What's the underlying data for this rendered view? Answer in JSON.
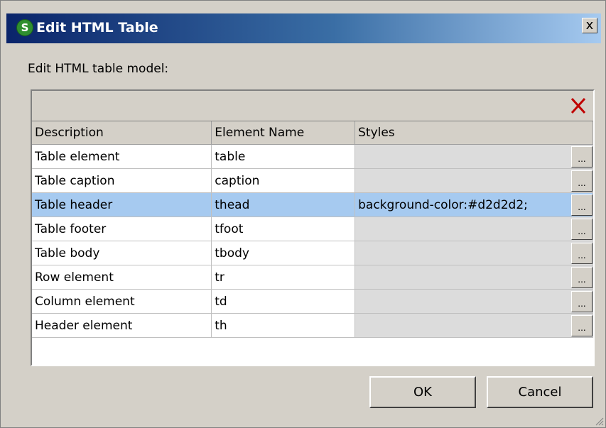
{
  "window": {
    "title": "Edit HTML Table",
    "close_label": "x",
    "app_icon_glyph": "S"
  },
  "prompt": "Edit HTML table model:",
  "columns": [
    "Description",
    "Element Name",
    "Styles"
  ],
  "rows": [
    {
      "description": "Table element",
      "element": "table",
      "styles": ""
    },
    {
      "description": "Table caption",
      "element": "caption",
      "styles": ""
    },
    {
      "description": "Table header",
      "element": "thead",
      "styles": "background-color:#d2d2d2;"
    },
    {
      "description": "Table footer",
      "element": "tfoot",
      "styles": ""
    },
    {
      "description": "Table body",
      "element": "tbody",
      "styles": ""
    },
    {
      "description": "Row element",
      "element": "tr",
      "styles": ""
    },
    {
      "description": "Column element",
      "element": "td",
      "styles": ""
    },
    {
      "description": "Header element",
      "element": "th",
      "styles": ""
    }
  ],
  "selected_row": 2,
  "ellipsis_label": "...",
  "buttons": {
    "ok": "OK",
    "cancel": "Cancel"
  },
  "colors": {
    "title_start": "#0a246a",
    "title_end": "#a6caf0",
    "selection": "#a6caf0",
    "delete_icon": "#c00000"
  },
  "icons": {
    "delete": "delete-icon",
    "app": "app-icon",
    "close": "close-icon",
    "resize": "resize-grip-icon"
  }
}
